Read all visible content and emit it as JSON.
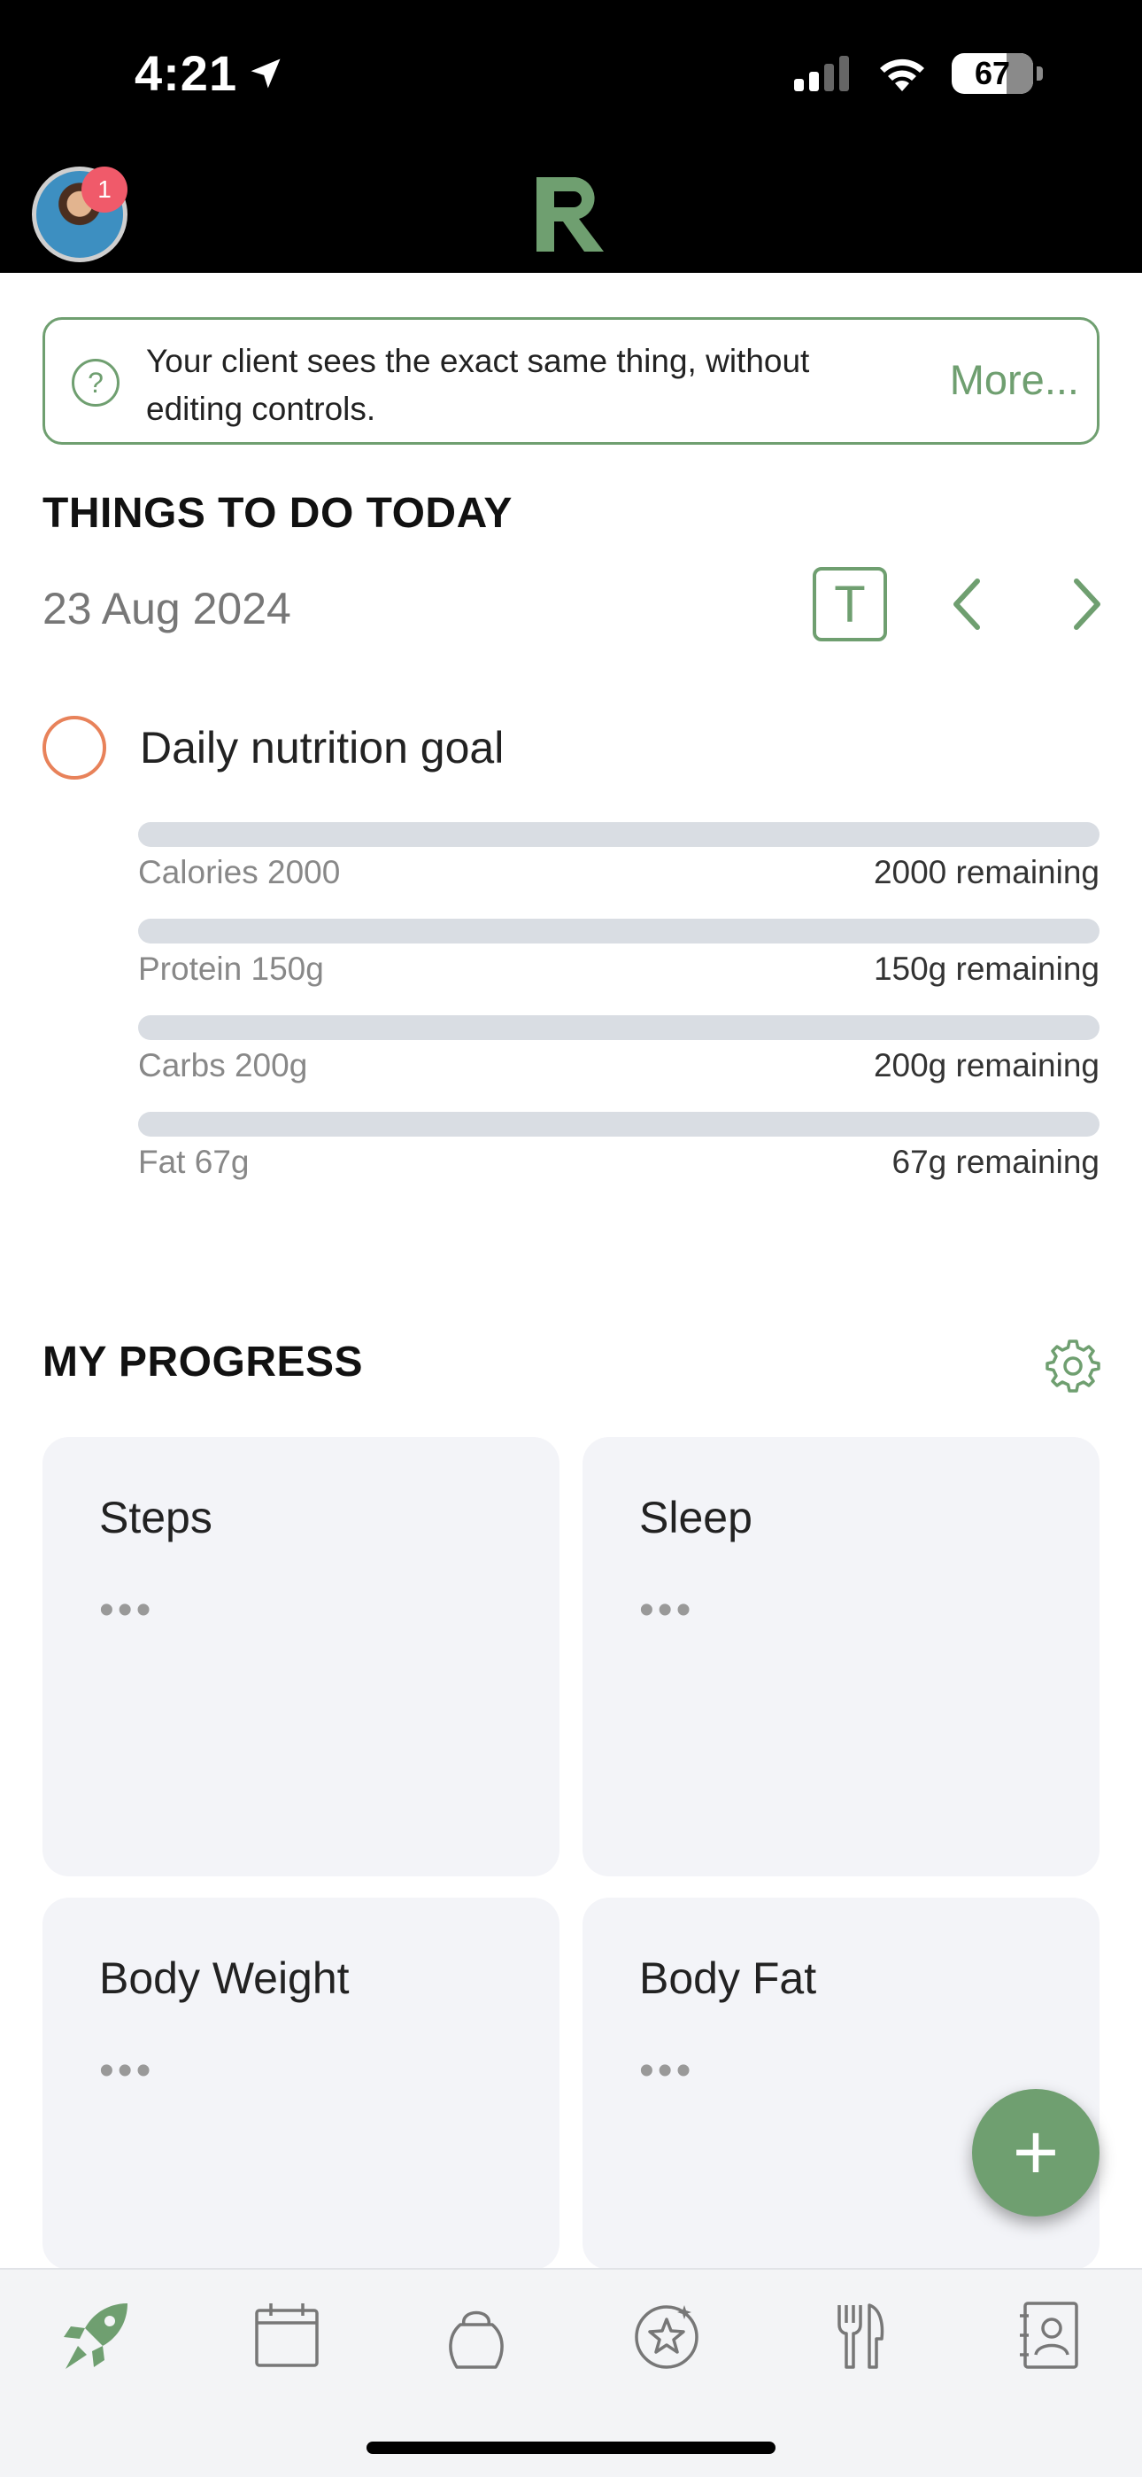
{
  "status_bar": {
    "time": "4:21",
    "battery": "67"
  },
  "header": {
    "notification_count": "1"
  },
  "banner": {
    "text": "Your client sees the exact same thing, without editing controls.",
    "more_label": "More...",
    "help_symbol": "?"
  },
  "today": {
    "heading": "THINGS TO DO TODAY",
    "date": "23 Aug 2024",
    "today_button": "T",
    "goal_label": "Daily nutrition goal",
    "macros": [
      {
        "name": "Calories 2000",
        "remaining": "2000 remaining",
        "progress": 0
      },
      {
        "name": "Protein 150g",
        "remaining": "150g remaining",
        "progress": 0
      },
      {
        "name": "Carbs 200g",
        "remaining": "200g remaining",
        "progress": 0
      },
      {
        "name": "Fat 67g",
        "remaining": "67g remaining",
        "progress": 0
      }
    ]
  },
  "progress": {
    "heading": "MY PROGRESS",
    "cards": [
      {
        "title": "Steps",
        "value": "•••"
      },
      {
        "title": "Sleep",
        "value": "•••"
      },
      {
        "title": "Body Weight",
        "value": "•••"
      },
      {
        "title": "Body Fat",
        "value": "•••"
      }
    ]
  },
  "fab": {
    "label": "+"
  },
  "tabs": [
    "rocket-icon",
    "calendar-icon",
    "kettlebell-icon",
    "star-badge-icon",
    "fork-knife-icon",
    "contacts-icon"
  ],
  "colors": {
    "accent": "#6f9f70",
    "goal_circle": "#e8825a",
    "card_bg": "#f3f4f8",
    "bar_bg": "#d9dde3"
  }
}
